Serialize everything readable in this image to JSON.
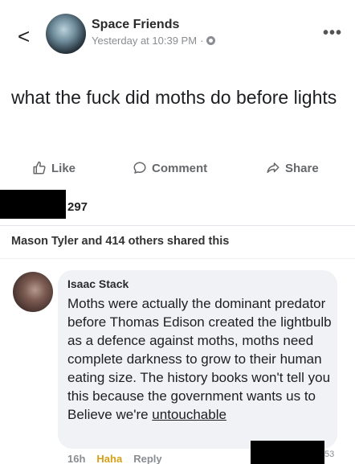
{
  "header": {
    "back_glyph": "<",
    "page_name": "Space Friends",
    "timestamp": "Yesterday at 10:39 PM",
    "separator": "·",
    "privacy_icon": "globe-icon",
    "more_glyph": "•••"
  },
  "post": {
    "text": "what the fuck did moths do before lights"
  },
  "actions": {
    "like_label": "Like",
    "comment_label": "Comment",
    "share_label": "Share"
  },
  "reactions": {
    "count_visible": "297"
  },
  "shares": {
    "text": "Mason Tyler and 414 others shared this"
  },
  "comment": {
    "author": "Isaac Stack",
    "text_main": "Moths were actually the dominant predator before Thomas Edison created the lightbulb as a defence against moths, moths need complete darkness to grow to their human eating size. The history books won't tell you this because the government wants us to Believe we're ",
    "text_underlined": "untouchable",
    "time": "16h",
    "reaction_label": "Haha",
    "reply_label": "Reply",
    "count_visible": "53"
  },
  "colors": {
    "bubble_bg": "#f0f2f5",
    "secondary_text": "#8a8d91",
    "haha_color": "#d4a017"
  }
}
